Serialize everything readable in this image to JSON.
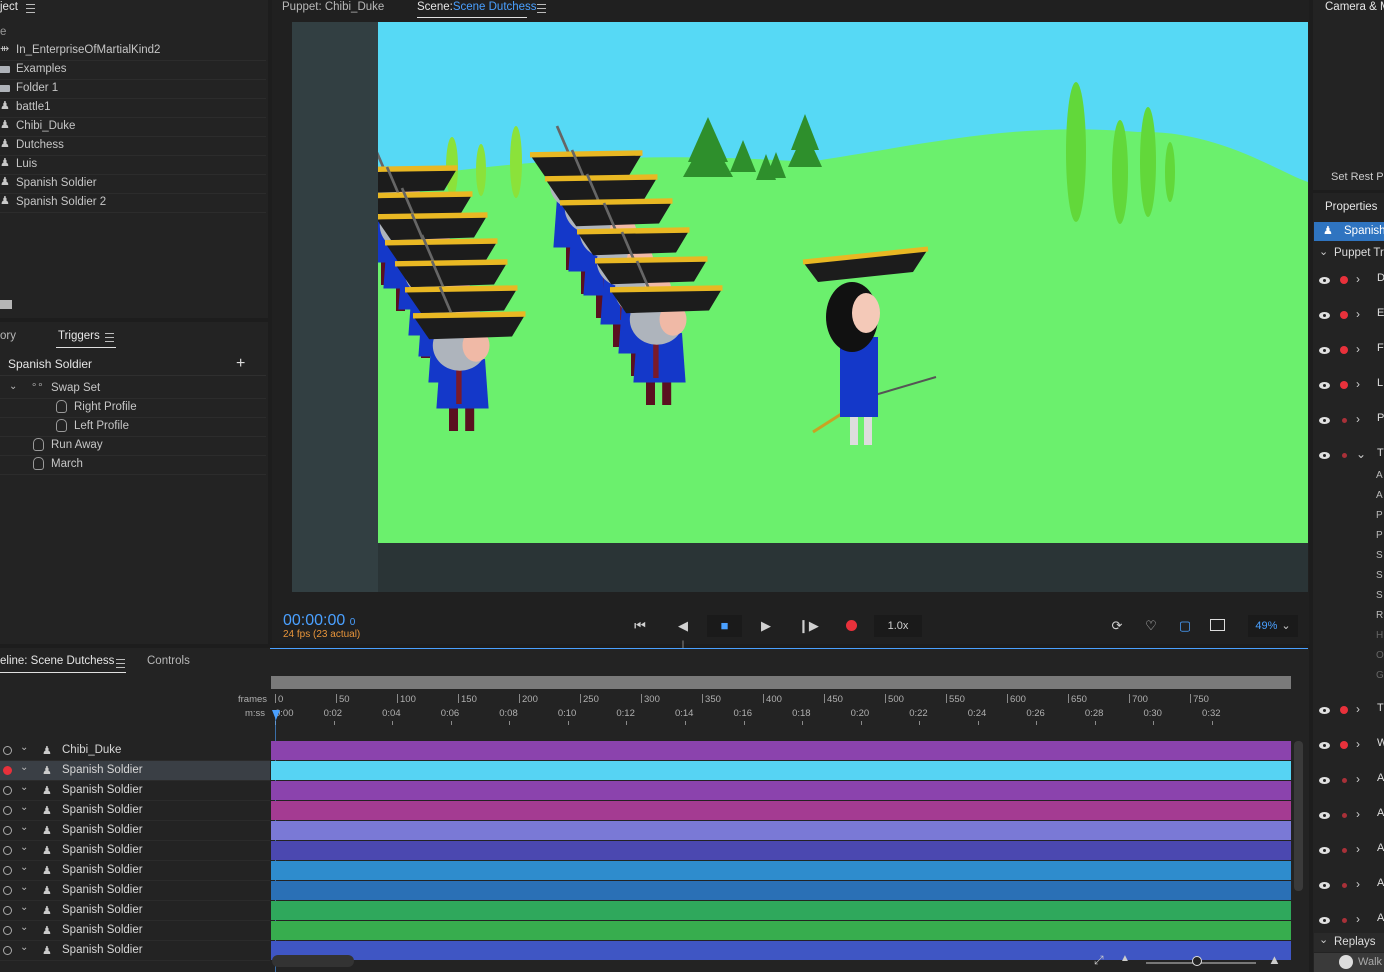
{
  "project": {
    "tab_label": "ject",
    "header_label": "e",
    "items": [
      {
        "label": "In_EnterpriseOfMartialKind2",
        "icon": "scene-icon"
      },
      {
        "label": "Examples",
        "icon": "folder-icon"
      },
      {
        "label": "Folder 1",
        "icon": "folder-icon"
      },
      {
        "label": "battle1",
        "icon": "puppet-icon"
      },
      {
        "label": "Chibi_Duke",
        "icon": "puppet-icon"
      },
      {
        "label": "Dutchess",
        "icon": "puppet-icon"
      },
      {
        "label": "Luis",
        "icon": "puppet-icon"
      },
      {
        "label": "Spanish Soldier",
        "icon": "puppet-icon"
      },
      {
        "label": "Spanish Soldier 2",
        "icon": "puppet-icon"
      }
    ]
  },
  "triggers": {
    "tab_prev": "ory",
    "tab_label": "Triggers",
    "puppet_name": "Spanish Soldier",
    "swap_set": "Swap Set",
    "items": [
      "Right Profile",
      "Left Profile",
      "Run Away",
      "March"
    ]
  },
  "viewer": {
    "tab_puppet": "Puppet: Chibi_Duke",
    "tab_scene_prefix": "Scene:",
    "tab_scene_name": "Scene Dutchess",
    "timecode": "00:00:00",
    "frame": "0",
    "fps": "24 fps (23 actual)",
    "speed": "1.0x",
    "zoom": "49%"
  },
  "timeline": {
    "tab_label": "eline: Scene Dutchess",
    "controls_tab": "Controls",
    "frames_label": "frames",
    "mss_label": "m:ss",
    "frame_ticks": [
      "0",
      "50",
      "100",
      "150",
      "200",
      "250",
      "300",
      "350",
      "400",
      "450",
      "500",
      "550",
      "600",
      "650",
      "700",
      "750"
    ],
    "time_ticks": [
      "0:00",
      "0:02",
      "0:04",
      "0:06",
      "0:08",
      "0:10",
      "0:12",
      "0:14",
      "0:16",
      "0:18",
      "0:20",
      "0:22",
      "0:24",
      "0:26",
      "0:28",
      "0:30",
      "0:32"
    ],
    "layers": [
      {
        "label": "Chibi_Duke",
        "color": "#8b43ad",
        "selected": false,
        "rec": false
      },
      {
        "label": "Spanish Soldier",
        "color": "#56d3f3",
        "selected": true,
        "rec": true
      },
      {
        "label": "Spanish Soldier",
        "color": "#8b43ad",
        "selected": false,
        "rec": false
      },
      {
        "label": "Spanish Soldier",
        "color": "#a43b92",
        "selected": false,
        "rec": false
      },
      {
        "label": "Spanish Soldier",
        "color": "#7a79d6",
        "selected": false,
        "rec": false
      },
      {
        "label": "Spanish Soldier",
        "color": "#4b48b0",
        "selected": false,
        "rec": false
      },
      {
        "label": "Spanish Soldier",
        "color": "#2e8ccd",
        "selected": false,
        "rec": false
      },
      {
        "label": "Spanish Soldier",
        "color": "#2a70b6",
        "selected": false,
        "rec": false
      },
      {
        "label": "Spanish Soldier",
        "color": "#2fa85c",
        "selected": false,
        "rec": false
      },
      {
        "label": "Spanish Soldier",
        "color": "#37ad4e",
        "selected": false,
        "rec": false
      },
      {
        "label": "Spanish Soldier",
        "color": "#3f56c4",
        "selected": false,
        "rec": false
      }
    ]
  },
  "right_panel": {
    "camera_tab": "Camera & M",
    "set_rest_pose": "Set Rest Pc",
    "properties_tab": "Properties",
    "selected_puppet": "Spanish",
    "puppet_track": "Puppet Tra",
    "behaviors_top": [
      "D",
      "E",
      "F",
      "L",
      "P",
      "T"
    ],
    "sublist": [
      "A",
      "A",
      "P",
      "P",
      "S",
      "S",
      "S",
      "R",
      "H",
      "O",
      "G"
    ],
    "behaviors_bottom": [
      "T",
      "W",
      "A",
      "A",
      "A",
      "A",
      "A"
    ],
    "replays_label": "Replays",
    "replay_item": "Walk"
  },
  "colors": {
    "accent": "#4aa0ff",
    "record": "#e8313b",
    "sky": "#56d9f5",
    "grass": "#6bf06d",
    "hat_gold": "#e9b823"
  }
}
